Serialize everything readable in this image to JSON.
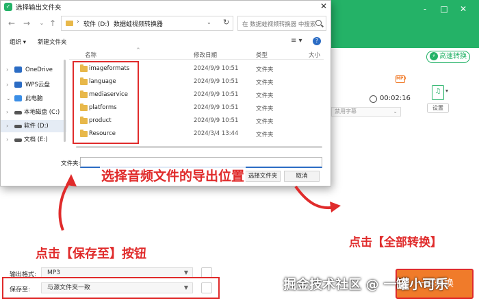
{
  "background_app": {
    "convert_mode_label": "高速转换",
    "file": {
      "format_badge": "MP3",
      "duration": "00:02:16",
      "subtitle_placeholder": "禁用字幕",
      "settings_label": "设置",
      "file_icon": "file-audio-icon"
    },
    "bottom": {
      "output_format_label": "输出格式:",
      "output_format_value": "MP3",
      "save_to_label": "保存至:",
      "save_to_value": "与源文件夹一致"
    },
    "window_controls": [
      "-",
      "□",
      "✕"
    ]
  },
  "dialog": {
    "title": "选择输出文件夹",
    "close_glyph": "✕",
    "nav": {
      "back": "←",
      "forward": "→",
      "up": "↑"
    },
    "address": {
      "crumbs": [
        "软件 (D:)",
        "数据蛙视频转换器"
      ],
      "sep": "›",
      "dropdown": "⌄",
      "refresh": "↻"
    },
    "search_placeholder": "在 数据蛙视频转换器 中搜索",
    "toolbar": {
      "organize": "组织 ▾",
      "new_folder": "新建文件夹",
      "view": "≡ ▾",
      "help": "?"
    },
    "nav_pane": [
      {
        "label": "OneDrive",
        "chev": "›",
        "icon_color": "#2b6cc4"
      },
      {
        "label": "WPS云盘",
        "chev": "›",
        "icon_color": "#2b6cc4"
      },
      {
        "label": "此电脑",
        "chev": "⌄",
        "icon_color": "#3a8ee6"
      },
      {
        "label": "本地磁盘 (C:)",
        "chev": "›",
        "icon_color": "#555555"
      },
      {
        "label": "软件 (D:)",
        "chev": "›",
        "icon_color": "#555555"
      },
      {
        "label": "文档 (E:)",
        "chev": "›",
        "icon_color": "#555555"
      }
    ],
    "columns": {
      "name": "名称",
      "date": "修改日期",
      "type": "类型",
      "size": "大小"
    },
    "sort_glyph": "^",
    "files": [
      {
        "name": "imageformats",
        "date": "2024/9/9 10:51",
        "type": "文件夹"
      },
      {
        "name": "language",
        "date": "2024/9/9 10:51",
        "type": "文件夹"
      },
      {
        "name": "mediaservice",
        "date": "2024/9/9 10:51",
        "type": "文件夹"
      },
      {
        "name": "platforms",
        "date": "2024/9/9 10:51",
        "type": "文件夹"
      },
      {
        "name": "product",
        "date": "2024/9/9 10:51",
        "type": "文件夹"
      },
      {
        "name": "Resource",
        "date": "2024/3/4 13:44",
        "type": "文件夹"
      }
    ],
    "filename_label": "文件夹:",
    "filename_value": "",
    "select_folder_button": "选择文件夹",
    "cancel_button": "取消"
  },
  "annotations": {
    "step1": "选择音频文件的导出位置",
    "step2": "点击【保存至】按钮",
    "step3": "点击【全部转换】",
    "watermark": "掘金技术社区 @ 一罐小可乐",
    "convert_all_button": "一键转换",
    "highlight_color": "#e02b2b"
  },
  "colors": {
    "brand_green": "#24b267",
    "accent_orange": "#f07b2a",
    "highlight_red": "#e02b2b"
  }
}
